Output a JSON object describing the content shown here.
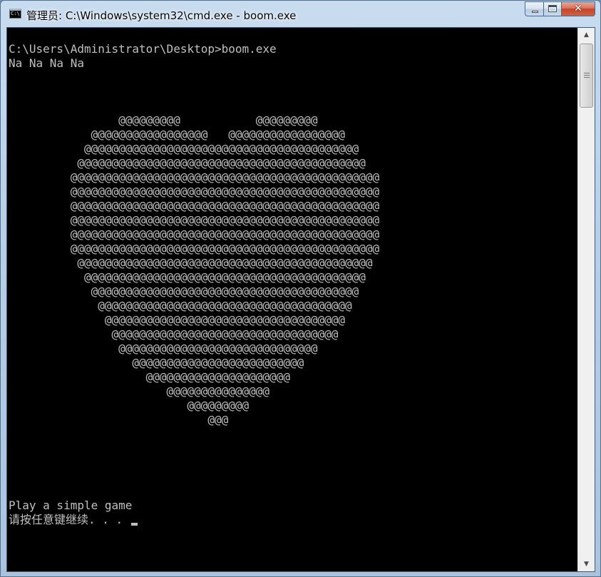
{
  "window": {
    "title": "管理员: C:\\Windows\\system32\\cmd.exe - boom.exe",
    "icon": "cmd-icon",
    "icon_text": "C:\\",
    "buttons": {
      "minimize": "minimize-icon",
      "maximize": "maximize-icon",
      "close": "✕"
    }
  },
  "console": {
    "lines": [
      "C:\\Users\\Administrator\\Desktop>boom.exe",
      "Na Na Na Na",
      "",
      "",
      "",
      "                @@@@@@@@@           @@@@@@@@@",
      "            @@@@@@@@@@@@@@@@@   @@@@@@@@@@@@@@@@@",
      "           @@@@@@@@@@@@@@@@@@@@@@@@@@@@@@@@@@@@@@@@",
      "          @@@@@@@@@@@@@@@@@@@@@@@@@@@@@@@@@@@@@@@@@@",
      "         @@@@@@@@@@@@@@@@@@@@@@@@@@@@@@@@@@@@@@@@@@@@@",
      "         @@@@@@@@@@@@@@@@@@@@@@@@@@@@@@@@@@@@@@@@@@@@@",
      "         @@@@@@@@@@@@@@@@@@@@@@@@@@@@@@@@@@@@@@@@@@@@@",
      "         @@@@@@@@@@@@@@@@@@@@@@@@@@@@@@@@@@@@@@@@@@@@@",
      "         @@@@@@@@@@@@@@@@@@@@@@@@@@@@@@@@@@@@@@@@@@@@@",
      "         @@@@@@@@@@@@@@@@@@@@@@@@@@@@@@@@@@@@@@@@@@@@@",
      "          @@@@@@@@@@@@@@@@@@@@@@@@@@@@@@@@@@@@@@@@@@@",
      "           @@@@@@@@@@@@@@@@@@@@@@@@@@@@@@@@@@@@@@@@@",
      "            @@@@@@@@@@@@@@@@@@@@@@@@@@@@@@@@@@@@@@@",
      "             @@@@@@@@@@@@@@@@@@@@@@@@@@@@@@@@@@@@@",
      "              @@@@@@@@@@@@@@@@@@@@@@@@@@@@@@@@@@@",
      "               @@@@@@@@@@@@@@@@@@@@@@@@@@@@@@@@@",
      "                @@@@@@@@@@@@@@@@@@@@@@@@@@@@@",
      "                  @@@@@@@@@@@@@@@@@@@@@@@@@",
      "                    @@@@@@@@@@@@@@@@@@@@@",
      "                       @@@@@@@@@@@@@@@",
      "                          @@@@@@@@@",
      "                             @@@",
      "",
      "",
      "",
      "",
      "",
      "Play a simple game",
      "请按任意键继续. . . "
    ]
  },
  "scrollbar": {
    "up": "▲",
    "down": "▼"
  }
}
